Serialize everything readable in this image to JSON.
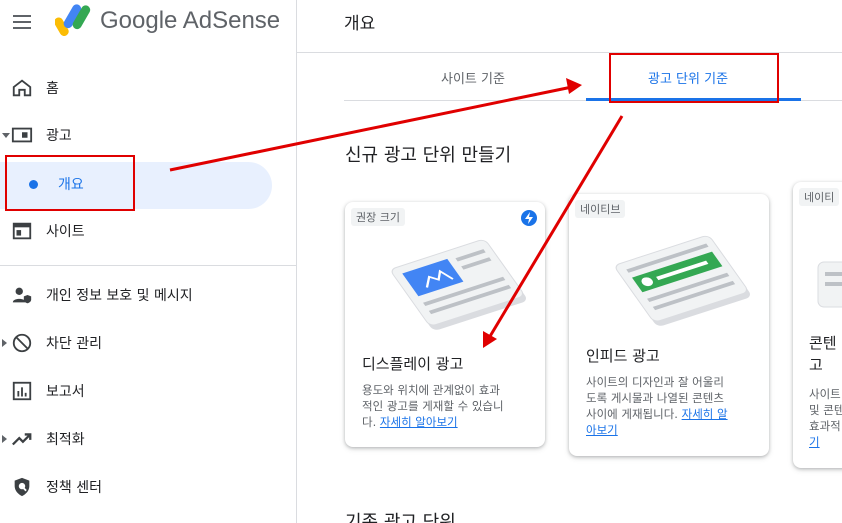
{
  "app": {
    "logo_text": "Google AdSense",
    "page_title": "개요"
  },
  "sidebar": {
    "items": [
      {
        "label": "홈"
      },
      {
        "label": "광고"
      },
      {
        "label": "개요"
      },
      {
        "label": "사이트"
      },
      {
        "label": "개인 정보 보호 및 메시지"
      },
      {
        "label": "차단 관리"
      },
      {
        "label": "보고서"
      },
      {
        "label": "최적화"
      },
      {
        "label": "정책 센터"
      }
    ]
  },
  "tabs": [
    {
      "label": "사이트 기준"
    },
    {
      "label": "광고 단위 기준"
    }
  ],
  "section": {
    "new_unit_title": "신규 광고 단위 만들기",
    "existing_title": "기존 광고 단위"
  },
  "cards": [
    {
      "badge": "권장 크기",
      "title": "디스플레이 광고",
      "desc_line1": "용도와 위치에 관계없이 효과",
      "desc_line2": "적인 광고를 게재할 수 있습니",
      "desc_line3": "다.",
      "link": "자세히 알아보기"
    },
    {
      "badge": "네이티브",
      "title": "인피드 광고",
      "desc_line1": "사이트의 디자인과 잘 어울리",
      "desc_line2": "도록 게시물과 나열된 콘텐츠",
      "desc_line3": "사이에 게재됩니다.",
      "link1": "자세히 알",
      "link2": "아보기"
    },
    {
      "badge": "네이티",
      "title_line1": "콘텐",
      "title_line2": "고",
      "desc_line1": "사이트",
      "desc_line2": "및 콘텐",
      "desc_line3": "효과적",
      "link": "기"
    }
  ],
  "colors": {
    "accent": "#1a73e8",
    "annotation": "#e00000",
    "active_bg": "#e8f0fe"
  }
}
